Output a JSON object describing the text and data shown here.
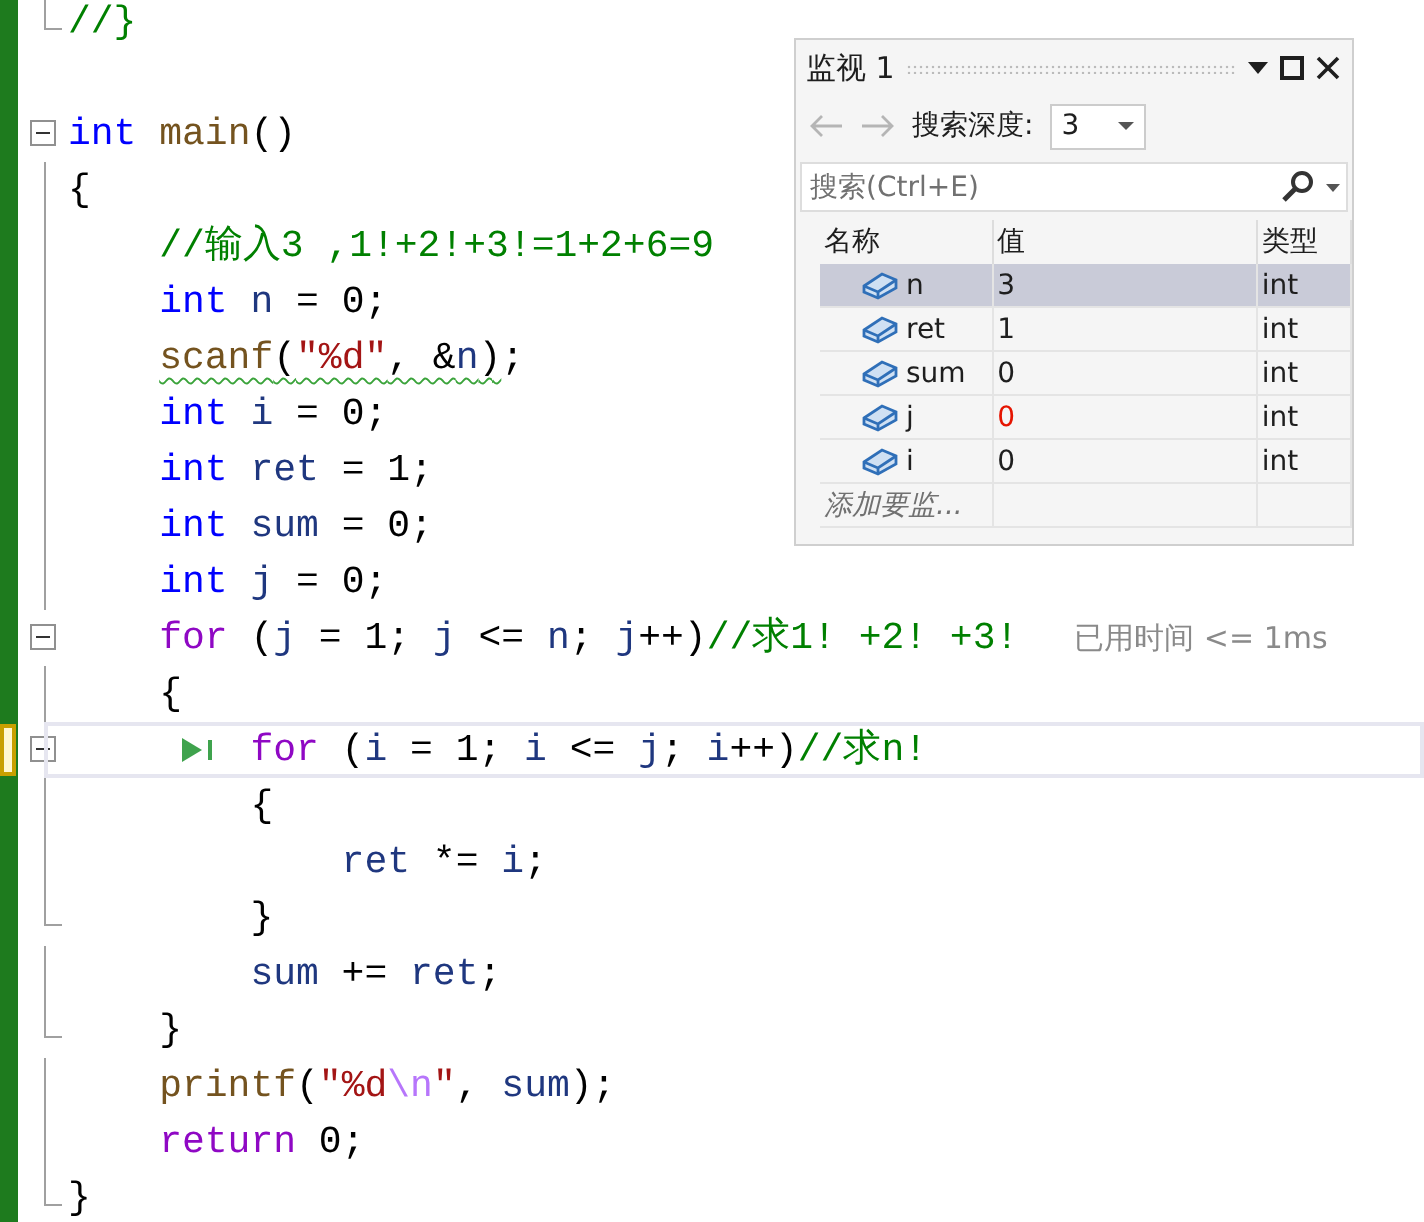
{
  "editor": {
    "lines": [
      {
        "kind": "end",
        "current": false,
        "squiggle": false,
        "tokens": [
          {
            "kind": "comment",
            "text": "//}"
          }
        ]
      },
      {
        "kind": "blank"
      },
      {
        "kind": "header",
        "current": false,
        "squiggle": false,
        "tokens": [
          {
            "kind": "keyword",
            "text": "int"
          },
          {
            "kind": "func",
            "text": " main"
          },
          {
            "kind": "plain",
            "text": "()"
          }
        ]
      },
      {
        "kind": "body",
        "current": false,
        "squiggle": false,
        "tokens": [
          {
            "kind": "plain",
            "text": "{"
          }
        ],
        "children": [
          {
            "kind": "body",
            "current": false,
            "squiggle": false,
            "tokens": [
              {
                "kind": "comment",
                "text": "//输入3 ,1!+2!+3!=1+2+6=9"
              }
            ]
          },
          {
            "kind": "body",
            "current": false,
            "squiggle": false,
            "tokens": [
              {
                "kind": "keyword",
                "text": "int"
              },
              {
                "kind": "ident",
                "text": " n"
              },
              {
                "kind": "plain",
                "text": " = 0;"
              }
            ]
          },
          {
            "kind": "body",
            "current": false,
            "squiggle": true,
            "tokens": [
              {
                "kind": "func",
                "text": "scanf"
              },
              {
                "kind": "plain",
                "text": "("
              },
              {
                "kind": "string",
                "text": "\"%d\""
              },
              {
                "kind": "plain",
                "text": ", &"
              },
              {
                "kind": "ident",
                "text": "n"
              },
              {
                "kind": "plain",
                "text": ")"
              },
              {
                "kind": "plain",
                "text": ";"
              }
            ]
          },
          {
            "kind": "body",
            "current": false,
            "squiggle": false,
            "tokens": [
              {
                "kind": "keyword",
                "text": "int"
              },
              {
                "kind": "ident",
                "text": " i"
              },
              {
                "kind": "plain",
                "text": " = 0;"
              }
            ]
          },
          {
            "kind": "body",
            "current": false,
            "squiggle": false,
            "tokens": [
              {
                "kind": "keyword",
                "text": "int"
              },
              {
                "kind": "ident",
                "text": " ret"
              },
              {
                "kind": "plain",
                "text": " = 1;"
              }
            ]
          },
          {
            "kind": "body",
            "current": false,
            "squiggle": false,
            "tokens": [
              {
                "kind": "keyword",
                "text": "int"
              },
              {
                "kind": "ident",
                "text": " sum"
              },
              {
                "kind": "plain",
                "text": " = 0;"
              }
            ]
          },
          {
            "kind": "body",
            "current": false,
            "squiggle": false,
            "tokens": [
              {
                "kind": "keyword",
                "text": "int"
              },
              {
                "kind": "ident",
                "text": " j"
              },
              {
                "kind": "plain",
                "text": " = 0;"
              }
            ]
          },
          {
            "kind": "header",
            "current": false,
            "squiggle": false,
            "hint": "已用时间 <= 1ms",
            "tokens": [
              {
                "kind": "control",
                "text": "for"
              },
              {
                "kind": "plain",
                "text": " ("
              },
              {
                "kind": "ident",
                "text": "j"
              },
              {
                "kind": "plain",
                "text": " = 1; "
              },
              {
                "kind": "ident",
                "text": "j"
              },
              {
                "kind": "plain",
                "text": " <= "
              },
              {
                "kind": "ident",
                "text": "n"
              },
              {
                "kind": "plain",
                "text": "; "
              },
              {
                "kind": "ident",
                "text": "j"
              },
              {
                "kind": "plain",
                "text": "++)"
              },
              {
                "kind": "comment",
                "text": "//求1! +2! +3!"
              }
            ]
          },
          {
            "kind": "body",
            "current": false,
            "squiggle": false,
            "tokens": [
              {
                "kind": "plain",
                "text": "{"
              }
            ],
            "children": [
              {
                "kind": "header",
                "current": true,
                "squiggle": false,
                "tokens": [
                  {
                    "kind": "control",
                    "text": "for"
                  },
                  {
                    "kind": "plain",
                    "text": " ("
                  },
                  {
                    "kind": "ident",
                    "text": "i"
                  },
                  {
                    "kind": "plain",
                    "text": " = 1; "
                  },
                  {
                    "kind": "ident",
                    "text": "i"
                  },
                  {
                    "kind": "plain",
                    "text": " <= "
                  },
                  {
                    "kind": "ident",
                    "text": "j"
                  },
                  {
                    "kind": "plain",
                    "text": "; "
                  },
                  {
                    "kind": "ident",
                    "text": "i"
                  },
                  {
                    "kind": "plain",
                    "text": "++)"
                  },
                  {
                    "kind": "comment",
                    "text": "//求n!"
                  }
                ]
              },
              {
                "kind": "body",
                "current": false,
                "squiggle": false,
                "tokens": [
                  {
                    "kind": "plain",
                    "text": "{"
                  }
                ],
                "children": [
                  {
                    "kind": "body",
                    "current": false,
                    "squiggle": false,
                    "tokens": [
                      {
                        "kind": "ident",
                        "text": "ret"
                      },
                      {
                        "kind": "plain",
                        "text": " *= "
                      },
                      {
                        "kind": "ident",
                        "text": "i"
                      },
                      {
                        "kind": "plain",
                        "text": ";"
                      }
                    ]
                  }
                ]
              },
              {
                "kind": "end",
                "current": false,
                "squiggle": false,
                "tokens": [
                  {
                    "kind": "plain",
                    "text": "}"
                  }
                ]
              },
              {
                "kind": "body",
                "current": false,
                "squiggle": false,
                "tokens": [
                  {
                    "kind": "ident",
                    "text": "sum"
                  },
                  {
                    "kind": "plain",
                    "text": " += "
                  },
                  {
                    "kind": "ident",
                    "text": "ret"
                  },
                  {
                    "kind": "plain",
                    "text": ";"
                  }
                ]
              }
            ]
          },
          {
            "kind": "end",
            "current": false,
            "squiggle": false,
            "tokens": [
              {
                "kind": "plain",
                "text": "}"
              }
            ]
          },
          {
            "kind": "body",
            "current": false,
            "squiggle": false,
            "tokens": [
              {
                "kind": "func",
                "text": "printf"
              },
              {
                "kind": "plain",
                "text": "("
              },
              {
                "kind": "string",
                "text": "\"%d"
              },
              {
                "kind": "escape",
                "text": "\\n"
              },
              {
                "kind": "string",
                "text": "\""
              },
              {
                "kind": "plain",
                "text": ", "
              },
              {
                "kind": "ident",
                "text": "sum"
              },
              {
                "kind": "plain",
                "text": ");"
              }
            ]
          },
          {
            "kind": "body",
            "current": false,
            "squiggle": false,
            "tokens": [
              {
                "kind": "control",
                "text": "return"
              },
              {
                "kind": "plain",
                "text": " 0;"
              }
            ]
          }
        ]
      },
      {
        "kind": "end",
        "current": false,
        "squiggle": false,
        "tokens": [
          {
            "kind": "plain",
            "text": "}"
          }
        ]
      }
    ]
  },
  "watch": {
    "title": "监视 1",
    "depth_label": "搜索深度:",
    "depth_value": "3",
    "search": {
      "placeholder": "搜索(Ctrl+E)"
    },
    "columns": [
      "名称",
      "值",
      "类型"
    ],
    "rows": [
      {
        "name": "n",
        "value": "3",
        "type": "int",
        "selected": true,
        "changed": false
      },
      {
        "name": "ret",
        "value": "1",
        "type": "int",
        "selected": false,
        "changed": false
      },
      {
        "name": "sum",
        "value": "0",
        "type": "int",
        "selected": false,
        "changed": false
      },
      {
        "name": "j",
        "value": "0",
        "type": "int",
        "selected": false,
        "changed": true
      },
      {
        "name": "i",
        "value": "0",
        "type": "int",
        "selected": false,
        "changed": false
      }
    ],
    "add_placeholder": "添加要监..."
  }
}
